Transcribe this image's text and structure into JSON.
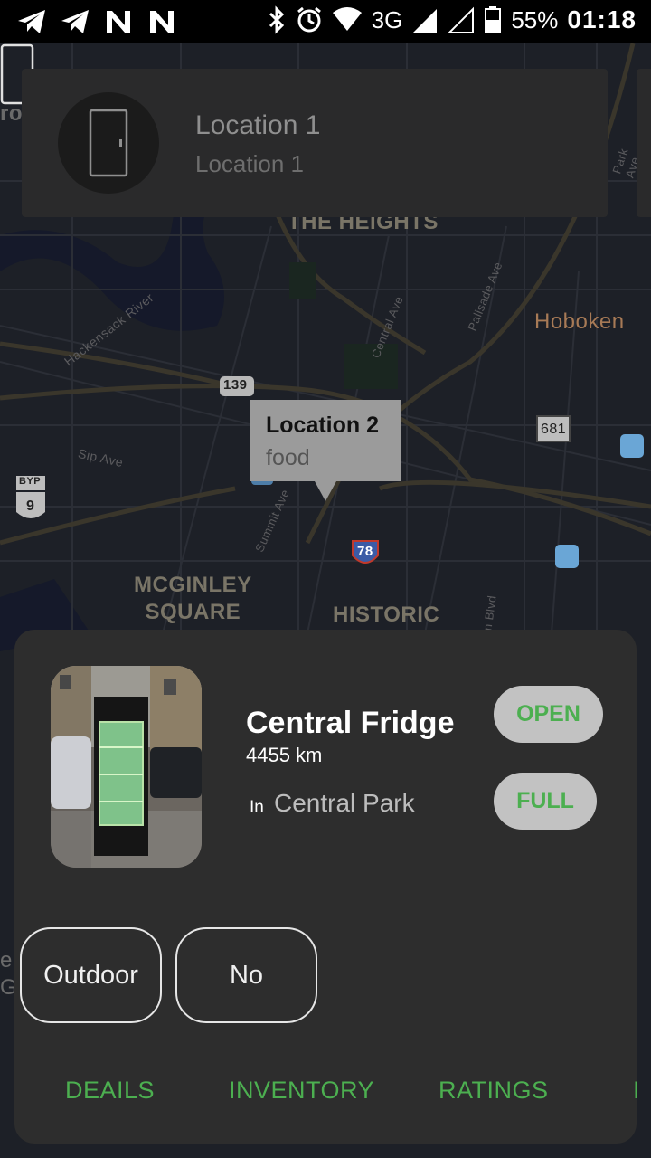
{
  "status_bar": {
    "network": "3G",
    "battery": "55%",
    "time": "01:18"
  },
  "map": {
    "labels": {
      "the_heights": "THE HEIGHTS",
      "hoboken": "Hoboken",
      "mcginley": "MCGINLEY\nSQUARE",
      "historic": "HISTORIC",
      "hackensack": "Hackensack River",
      "palisade": "Palisade Ave",
      "central_ave": "Central Ave",
      "sip_ave": "Sip Ave",
      "summit_ave": "Summit Ave",
      "park_ave": "Park Ave",
      "blvd": "n Blvd",
      "rox": "rox",
      "er": "er",
      "g": "G"
    },
    "shields": {
      "route139": "139",
      "route681": "681",
      "byp": "BYP",
      "us9": "9",
      "i78": "78"
    }
  },
  "top_card": {
    "title": "Location 1",
    "subtitle": "Location 1",
    "icon": "door-icon"
  },
  "tooltip": {
    "title": "Location 2",
    "subtitle": "food"
  },
  "sheet": {
    "name": "Central Fridge",
    "distance": "4455 km",
    "in_label": "In",
    "place": "Central Park",
    "status_open": "OPEN",
    "status_full": "FULL",
    "tags": [
      "Outdoor",
      "No"
    ],
    "tabs": [
      "DEAILS",
      "INVENTORY",
      "RATINGS",
      "I"
    ],
    "accent": "#4caf50"
  }
}
